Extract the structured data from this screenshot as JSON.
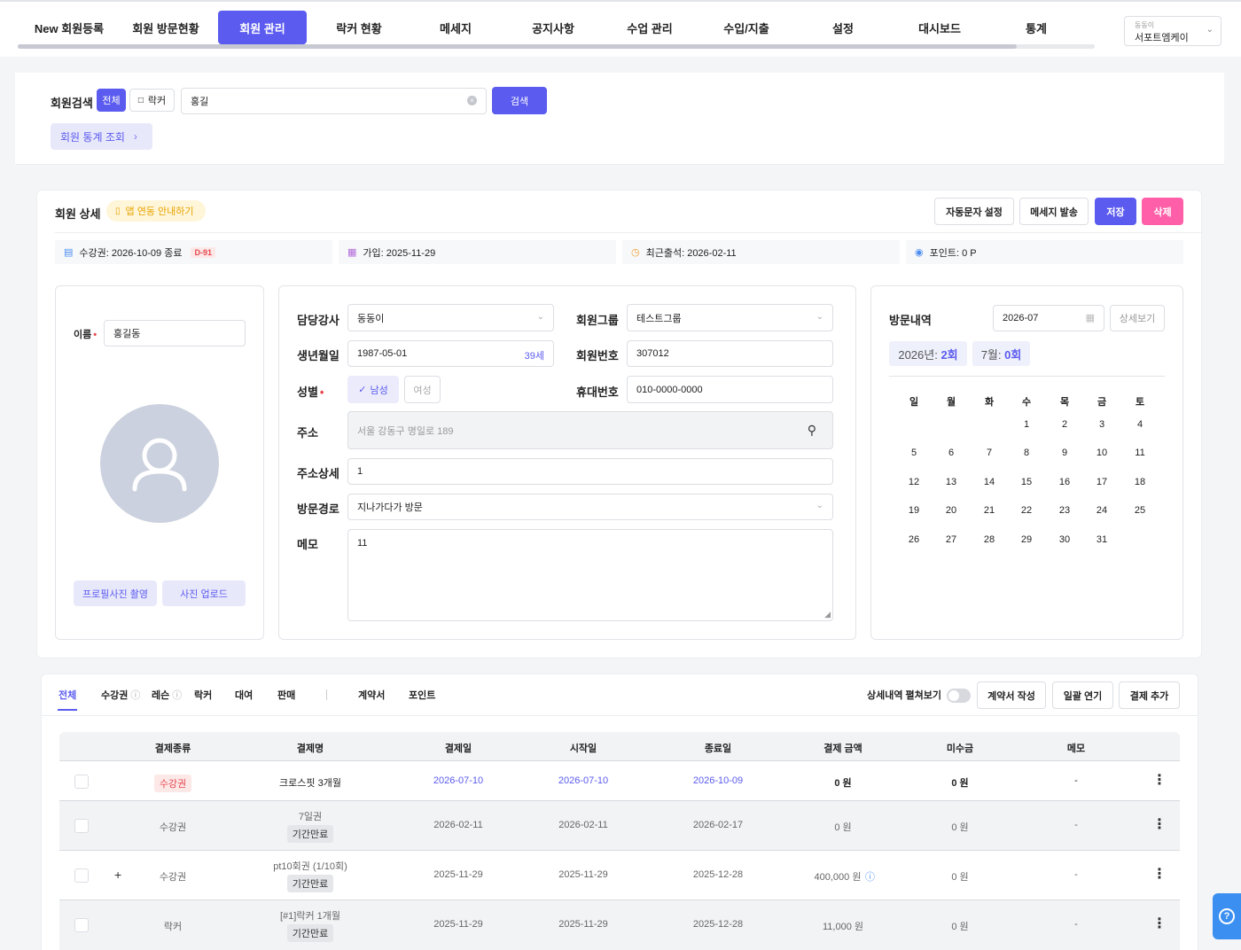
{
  "nav": {
    "tabs": [
      "New 회원등록",
      "회원 방문현황",
      "회원 관리",
      "락커 현황",
      "메세지",
      "공지사항",
      "수업 관리",
      "수입/지출",
      "설정",
      "대시보드",
      "통계"
    ],
    "store_small": "동동이",
    "store_name": "서포트엠케이"
  },
  "search": {
    "label": "회원검색",
    "filter_all": "전체",
    "filter_locker": "락커",
    "value": "홍길",
    "button": "검색",
    "stats_link": "회원 통계 조회"
  },
  "detail": {
    "title": "회원 상세",
    "app_link": "앱 연동 안내하기",
    "buttons": {
      "auto_sms": "자동문자 설정",
      "send_msg": "메세지 발송",
      "save": "저장",
      "delete": "삭제"
    },
    "info": {
      "membership": "수강권: 2026-10-09 종료",
      "dday": "D-91",
      "joined": "가입: 2025-11-29",
      "last_visit": "최근출석: 2026-02-11",
      "points": "포인트: 0 P"
    }
  },
  "profile": {
    "name_label": "이름",
    "name_value": "홍길동",
    "btn_capture": "프로필사진 촬영",
    "btn_upload": "사진 업로드"
  },
  "form": {
    "trainer_label": "담당강사",
    "trainer_value": "동동이",
    "group_label": "회원그룹",
    "group_value": "테스트그룹",
    "birth_label": "생년월일",
    "birth_value": "1987-05-01",
    "age": "39세",
    "member_no_label": "회원번호",
    "member_no_value": "307012",
    "gender_label": "성별",
    "gender_male": "남성",
    "gender_female": "여성",
    "phone_label": "휴대번호",
    "phone_value": "010-0000-0000",
    "address_label": "주소",
    "address_placeholder": "서울 강동구 명일로 189",
    "address_detail_label": "주소상세",
    "address_detail_value": "1",
    "route_label": "방문경로",
    "route_value": "지나가다가 방문",
    "memo_label": "메모",
    "memo_value": "11"
  },
  "visits": {
    "title": "방문내역",
    "month": "2026-07",
    "detail_btn": "상세보기",
    "year_pre": "2026년: ",
    "year_count": "2회",
    "month_pre": "7월: ",
    "month_count": "0회",
    "weekdays": [
      "일",
      "월",
      "화",
      "수",
      "목",
      "금",
      "토"
    ],
    "days": [
      "1",
      "2",
      "3",
      "4",
      "5",
      "6",
      "7",
      "8",
      "9",
      "10",
      "11",
      "12",
      "13",
      "14",
      "15",
      "16",
      "17",
      "18",
      "19",
      "20",
      "21",
      "22",
      "23",
      "24",
      "25",
      "26",
      "27",
      "28",
      "29",
      "30",
      "31"
    ]
  },
  "payments": {
    "tabs": [
      "전체",
      "수강권",
      "레슨",
      "락커",
      "대여",
      "판매",
      "계약서",
      "포인트"
    ],
    "toggle_label": "상세내역 펼쳐보기",
    "btn_contract": "계약서 작성",
    "btn_extend": "일괄 연기",
    "btn_add": "결제 추가",
    "headers": [
      "결제종류",
      "결제명",
      "결제일",
      "시작일",
      "종료일",
      "결제 금액",
      "미수금",
      "메모"
    ],
    "rows": [
      {
        "type": "수강권",
        "name": "크로스핏 3개월",
        "status": "",
        "paid": "2026-07-10",
        "start": "2026-07-10",
        "end": "2026-10-09",
        "amount": "0 원",
        "unpaid": "0 원",
        "memo": "-"
      },
      {
        "type": "수강권",
        "name": "7일권",
        "status": "기간만료",
        "paid": "2026-02-11",
        "start": "2026-02-11",
        "end": "2026-02-17",
        "amount": "0 원",
        "unpaid": "0 원",
        "memo": "-"
      },
      {
        "type": "수강권",
        "name": "pt10회권 (1/10회)",
        "status": "기간만료",
        "paid": "2025-11-29",
        "start": "2025-11-29",
        "end": "2025-12-28",
        "amount": "400,000 원",
        "unpaid": "0 원",
        "memo": "-"
      },
      {
        "type": "락커",
        "name": "[#1]락커 1개월",
        "status": "기간만료",
        "paid": "2025-11-29",
        "start": "2025-11-29",
        "end": "2025-12-28",
        "amount": "11,000 원",
        "unpaid": "0 원",
        "memo": "-"
      }
    ]
  }
}
